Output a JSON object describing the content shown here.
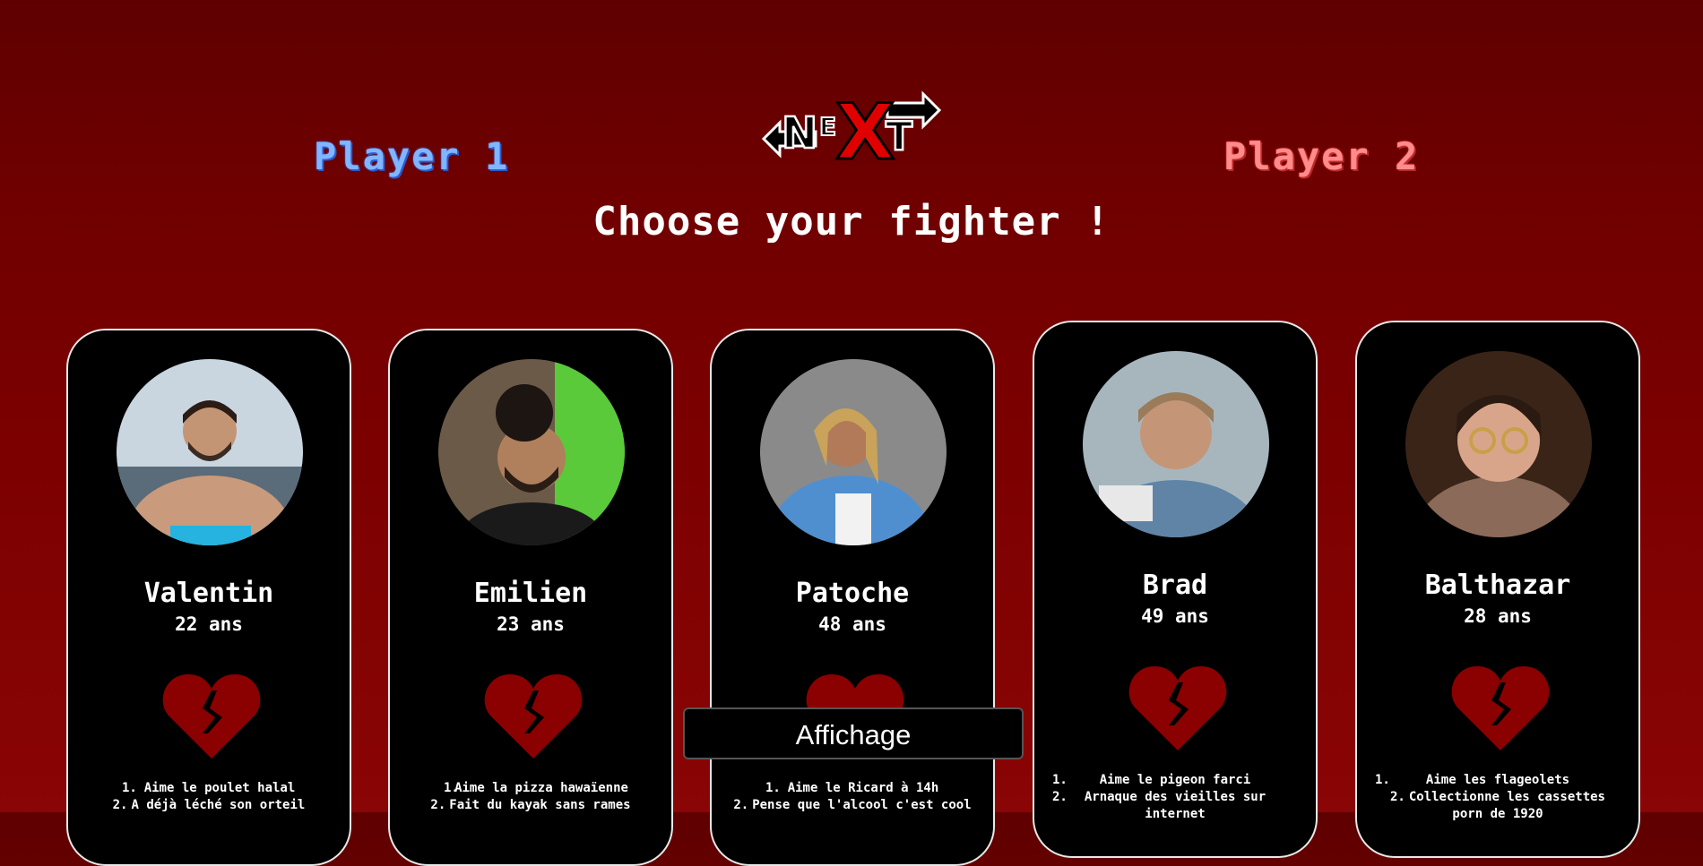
{
  "header": {
    "player1": "Player 1",
    "player2": "Player 2",
    "logo_text": "NEXT",
    "headline": "Choose your fighter !"
  },
  "colors": {
    "player1": "#7fb6ff",
    "player2": "#ff8c8c",
    "heart": "#8b0000",
    "card_bg": "#000000"
  },
  "fighters": [
    {
      "name": "Valentin",
      "age": "22 ans",
      "likes": [
        "Aime le poulet halal",
        "A déjà léché son orteil"
      ]
    },
    {
      "name": "Emilien",
      "age": "23 ans",
      "likes": [
        "Aime la pizza hawaïenne",
        "Fait du kayak sans rames"
      ]
    },
    {
      "name": "Patoche",
      "age": "48 ans",
      "likes": [
        "Aime le Ricard à 14h",
        "Pense que l'alcool c'est cool"
      ]
    },
    {
      "name": "Brad",
      "age": "49 ans",
      "likes": [
        "Aime le pigeon farci",
        "Arnaque des vieilles sur internet"
      ]
    },
    {
      "name": "Balthazar",
      "age": "28 ans",
      "likes": [
        "Aime les flageolets",
        "Collectionne les cassettes porn de 1920"
      ]
    }
  ],
  "overlay": {
    "button": "Affichage"
  }
}
